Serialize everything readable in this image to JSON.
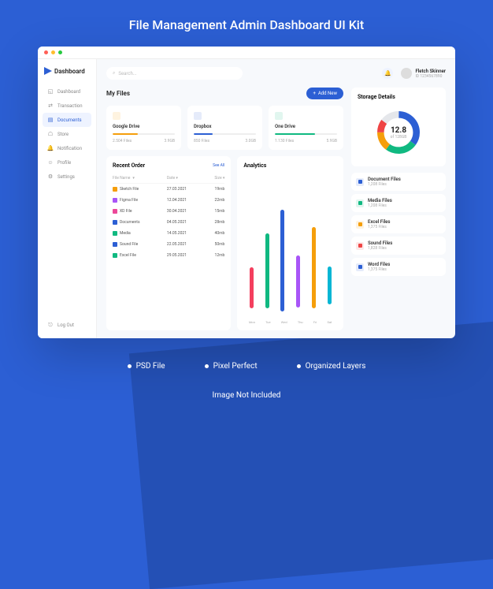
{
  "page": {
    "title": "File Management Admin Dashboard UI Kit",
    "features": [
      "PSD File",
      "Pixel Perfect",
      "Organized Layers"
    ],
    "disclaimer": "Image Not Included"
  },
  "brand": "Dashboard",
  "search": {
    "placeholder": "Search..."
  },
  "user": {
    "name": "Fletch Skinner",
    "id": "ID 1234567890"
  },
  "nav": {
    "items": [
      {
        "label": "Dashboard",
        "icon": "◱"
      },
      {
        "label": "Transaction",
        "icon": "⇄"
      },
      {
        "label": "Documents",
        "icon": "▤",
        "active": true
      },
      {
        "label": "Store",
        "icon": "☖"
      },
      {
        "label": "Notification",
        "icon": "🔔"
      },
      {
        "label": "Profile",
        "icon": "☺"
      },
      {
        "label": "Settings",
        "icon": "⚙"
      }
    ],
    "logout": "Log Out"
  },
  "myFiles": {
    "title": "My Files",
    "addBtn": "Add New",
    "cards": [
      {
        "name": "Google Drive",
        "color": "#F59E0B",
        "pct": 40,
        "files": "2.504 Files",
        "size": "3.9GB"
      },
      {
        "name": "Dropbox",
        "color": "#2C5FD4",
        "pct": 30,
        "files": "850 Files",
        "size": "3.0GB"
      },
      {
        "name": "One Drive",
        "color": "#10B981",
        "pct": 65,
        "files": "1.130 Files",
        "size": "5.9GB"
      }
    ]
  },
  "recent": {
    "title": "Recent Order",
    "seeAll": "See All",
    "cols": {
      "name": "File Name",
      "date": "Date",
      "size": "Size"
    },
    "rows": [
      {
        "name": "Sketch File",
        "date": "27.03.2021",
        "size": "19mb",
        "color": "#F59E0B"
      },
      {
        "name": "Figma File",
        "date": "12.04.2021",
        "size": "22mb",
        "color": "#A855F7"
      },
      {
        "name": "XD File",
        "date": "30.04.2021",
        "size": "15mb",
        "color": "#EC4899"
      },
      {
        "name": "Documents",
        "date": "04.05.2021",
        "size": "28mb",
        "color": "#2C5FD4"
      },
      {
        "name": "Media",
        "date": "14.05.2021",
        "size": "40mb",
        "color": "#10B981"
      },
      {
        "name": "Sound File",
        "date": "22.05.2021",
        "size": "50mb",
        "color": "#2C5FD4"
      },
      {
        "name": "Excel File",
        "date": "29.05.2021",
        "size": "12mb",
        "color": "#10B981"
      }
    ]
  },
  "analytics": {
    "title": "Analytics"
  },
  "chart_data": {
    "type": "bar",
    "categories": [
      "Mon",
      "Tue",
      "Wed",
      "Thu",
      "Fri",
      "Sat"
    ],
    "series": [
      {
        "name": "Mon",
        "color": "#F43F5E",
        "top": 60,
        "height": 30
      },
      {
        "name": "Tue",
        "color": "#10B981",
        "top": 35,
        "height": 55
      },
      {
        "name": "Wed",
        "color": "#2C5FD4",
        "top": 20,
        "height": 75
      },
      {
        "name": "Thu",
        "color": "#A855F7",
        "top": 50,
        "height": 38
      },
      {
        "name": "Fri",
        "color": "#F59E0B",
        "top": 30,
        "height": 60
      },
      {
        "name": "Sat",
        "color": "#06B6D4",
        "top": 55,
        "height": 28
      }
    ],
    "ylim": [
      0,
      100
    ]
  },
  "storage": {
    "title": "Storage Details",
    "value": "12.8",
    "sub": "of 128GB",
    "segments": [
      {
        "color": "#2C5FD4",
        "pct": 35
      },
      {
        "color": "#10B981",
        "pct": 25
      },
      {
        "color": "#F59E0B",
        "pct": 15
      },
      {
        "color": "#EF4444",
        "pct": 10
      },
      {
        "color": "#E5E7EB",
        "pct": 15
      }
    ]
  },
  "fileTypes": [
    {
      "name": "Document Files",
      "count": "1,208 Files",
      "color": "#2C5FD4"
    },
    {
      "name": "Media Files",
      "count": "1,208 Files",
      "color": "#10B981"
    },
    {
      "name": "Excel Files",
      "count": "1,375 Files",
      "color": "#F59E0B"
    },
    {
      "name": "Sound Files",
      "count": "1,828 Files",
      "color": "#EF4444"
    },
    {
      "name": "Word Files",
      "count": "1,375 Files",
      "color": "#2C5FD4"
    }
  ]
}
